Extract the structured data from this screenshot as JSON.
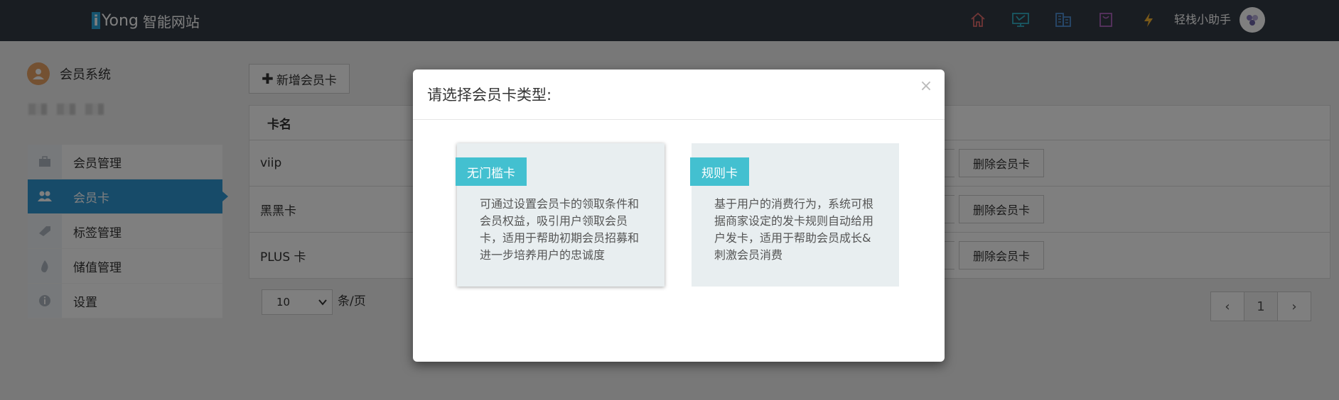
{
  "app": {
    "logo_mark": "i",
    "brand": "Yong",
    "subtitle": "智能网站"
  },
  "topbar": {
    "icons": [
      "home-icon",
      "monitor-icon",
      "building-icon",
      "bag-icon",
      "lightning-icon"
    ],
    "user_name": "轻栈小助手",
    "colors": {
      "home": "#e06c6c",
      "monitor": "#33b3c8",
      "building": "#4f91d6",
      "bag": "#b064c0",
      "lightning": "#f2b233"
    }
  },
  "sidebar": {
    "title": "会员系统",
    "items": [
      {
        "label": "会员管理",
        "icon": "briefcase-icon",
        "active": false
      },
      {
        "label": "会员卡",
        "icon": "users-icon",
        "active": true
      },
      {
        "label": "标签管理",
        "icon": "tag-icon",
        "active": false
      },
      {
        "label": "储值管理",
        "icon": "fire-icon",
        "active": false
      },
      {
        "label": "设置",
        "icon": "info-icon",
        "active": false
      }
    ]
  },
  "main": {
    "add_button": "新增会员卡",
    "table": {
      "header": "卡名",
      "rows": [
        {
          "name": "viip",
          "delete": "删除会员卡"
        },
        {
          "name": "黑黑卡",
          "delete": "删除会员卡"
        },
        {
          "name": "PLUS 卡",
          "delete": "删除会员卡"
        }
      ]
    },
    "page_size": "10",
    "page_size_label": "条/页",
    "pager": {
      "prev": "‹",
      "current": "1",
      "next": "›"
    }
  },
  "modal": {
    "title": "请选择会员卡类型:",
    "close": "×",
    "cards": [
      {
        "tag": "无门槛卡",
        "desc": "可通过设置会员卡的领取条件和会员权益，吸引用户领取会员卡，适用于帮助初期会员招募和进一步培养用户的忠诚度"
      },
      {
        "tag": "规则卡",
        "desc": "基于用户的消费行为，系统可根据商家设定的发卡规则自动给用户发卡，适用于帮助会员成长&刺激会员消费"
      }
    ]
  },
  "colors": {
    "topbar": "#333a45",
    "accent": "#2e96d3",
    "tag": "#43c0d0"
  }
}
